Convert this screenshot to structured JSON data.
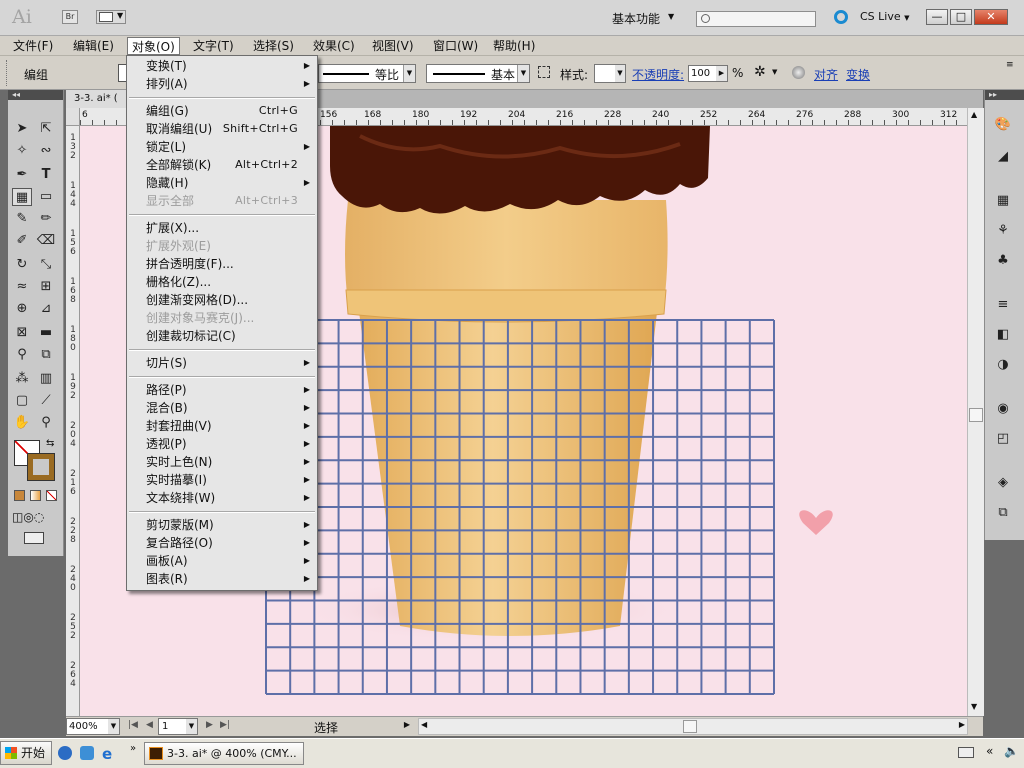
{
  "app": {
    "logo": "Ai",
    "bridge_label": "Br",
    "workspace_label": "基本功能",
    "cs_live_label": "CS Live",
    "window_controls": {
      "minimize": "—",
      "restore": "□",
      "close": "✕"
    }
  },
  "menubar": {
    "items": [
      "文件(F)",
      "编辑(E)",
      "对象(O)",
      "文字(T)",
      "选择(S)",
      "效果(C)",
      "视图(V)",
      "窗口(W)",
      "帮助(H)"
    ],
    "active_index": 2
  },
  "control_bar": {
    "selection_label": "编组",
    "stroke_profile": "等比",
    "brush_label": "基本",
    "style_label": "样式:",
    "opacity_label": "不透明度:",
    "opacity_value": "100",
    "opacity_unit": "%",
    "align_label": "对齐",
    "transform_label": "变换"
  },
  "document": {
    "tab_title": "3-3. ai* (",
    "zoom": "400%",
    "artboard_num": "1",
    "status": "选择"
  },
  "rulers": {
    "h_ticks": [
      "6",
      "156",
      "168",
      "180",
      "192",
      "204",
      "216",
      "228",
      "240",
      "252",
      "264",
      "276",
      "288",
      "300",
      "312"
    ],
    "v_labels": [
      "1 3 2",
      "1 4 4",
      "1 5 6",
      "1 6 8",
      "1 8 0",
      "1 9 2",
      "2 0 4",
      "2 1 6",
      "2 2 8",
      "2 4 0",
      "2 5 2",
      "2 6 4"
    ]
  },
  "object_menu": {
    "items": [
      {
        "label": "变换(T)",
        "shortcut": "",
        "submenu": true,
        "disabled": false
      },
      {
        "label": "排列(A)",
        "shortcut": "",
        "submenu": true,
        "disabled": false
      },
      {
        "sep": true
      },
      {
        "label": "编组(G)",
        "shortcut": "Ctrl+G",
        "submenu": false,
        "disabled": false
      },
      {
        "label": "取消编组(U)",
        "shortcut": "Shift+Ctrl+G",
        "submenu": false,
        "disabled": false
      },
      {
        "label": "锁定(L)",
        "shortcut": "",
        "submenu": true,
        "disabled": false
      },
      {
        "label": "全部解锁(K)",
        "shortcut": "Alt+Ctrl+2",
        "submenu": false,
        "disabled": false
      },
      {
        "label": "隐藏(H)",
        "shortcut": "",
        "submenu": true,
        "disabled": false
      },
      {
        "label": "显示全部",
        "shortcut": "Alt+Ctrl+3",
        "submenu": false,
        "disabled": true
      },
      {
        "sep": true
      },
      {
        "label": "扩展(X)...",
        "shortcut": "",
        "submenu": false,
        "disabled": false
      },
      {
        "label": "扩展外观(E)",
        "shortcut": "",
        "submenu": false,
        "disabled": true
      },
      {
        "label": "拼合透明度(F)...",
        "shortcut": "",
        "submenu": false,
        "disabled": false
      },
      {
        "label": "栅格化(Z)...",
        "shortcut": "",
        "submenu": false,
        "disabled": false
      },
      {
        "label": "创建渐变网格(D)...",
        "shortcut": "",
        "submenu": false,
        "disabled": false
      },
      {
        "label": "创建对象马赛克(J)...",
        "shortcut": "",
        "submenu": false,
        "disabled": true
      },
      {
        "label": "创建裁切标记(C)",
        "shortcut": "",
        "submenu": false,
        "disabled": false
      },
      {
        "sep": true
      },
      {
        "label": "切片(S)",
        "shortcut": "",
        "submenu": true,
        "disabled": false
      },
      {
        "sep": true
      },
      {
        "label": "路径(P)",
        "shortcut": "",
        "submenu": true,
        "disabled": false
      },
      {
        "label": "混合(B)",
        "shortcut": "",
        "submenu": true,
        "disabled": false
      },
      {
        "label": "封套扭曲(V)",
        "shortcut": "",
        "submenu": true,
        "disabled": false
      },
      {
        "label": "透视(P)",
        "shortcut": "",
        "submenu": true,
        "disabled": false
      },
      {
        "label": "实时上色(N)",
        "shortcut": "",
        "submenu": true,
        "disabled": false
      },
      {
        "label": "实时描摹(I)",
        "shortcut": "",
        "submenu": true,
        "disabled": false
      },
      {
        "label": "文本绕排(W)",
        "shortcut": "",
        "submenu": true,
        "disabled": false
      },
      {
        "sep": true
      },
      {
        "label": "剪切蒙版(M)",
        "shortcut": "",
        "submenu": true,
        "disabled": false
      },
      {
        "label": "复合路径(O)",
        "shortcut": "",
        "submenu": true,
        "disabled": false
      },
      {
        "label": "画板(A)",
        "shortcut": "",
        "submenu": true,
        "disabled": false
      },
      {
        "label": "图表(R)",
        "shortcut": "",
        "submenu": true,
        "disabled": false
      }
    ]
  },
  "taskbar": {
    "start_label": "开始",
    "task_label": "3-3. ai* @ 400% (CMY..."
  },
  "colors": {
    "canvas_bg": "#f9e1e9",
    "grid_stroke": "#5e6fa8",
    "cone": "#e9b86a",
    "chocolate": "#4a1607",
    "heart": "#f2a0aa",
    "link": "#1a3fb5"
  }
}
